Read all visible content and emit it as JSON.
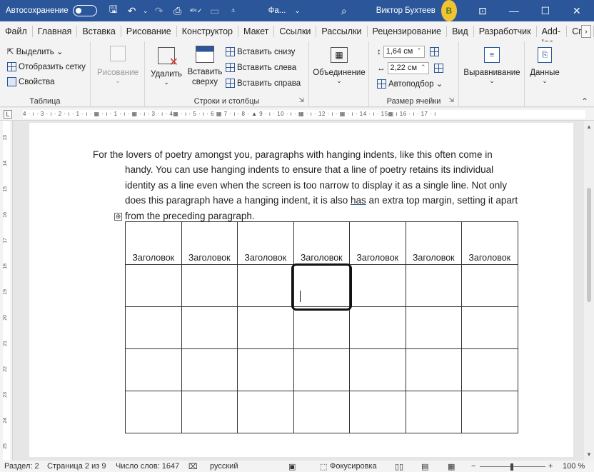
{
  "titlebar": {
    "autosave_label": "Автосохранение",
    "doc_title": "Фа...",
    "doc_title_arrow": "⌄",
    "user_name": "Виктор Бухтеев",
    "avatar_initial": "В",
    "icons": [
      "save-icon",
      "undo-icon",
      "redo-icon",
      "print-preview-icon",
      "spelling-icon",
      "form-icon",
      "customize-quick-access-icon",
      "search-icon",
      "ribbon-display-icon",
      "minimize-icon",
      "maximize-icon",
      "close-icon"
    ],
    "accent_color": "#2b579a"
  },
  "tabs": [
    "Файл",
    "Главная",
    "Вставка",
    "Рисование",
    "Конструктор",
    "Макет",
    "Ссылки",
    "Рассылки",
    "Рецензирование",
    "Вид",
    "Разработчик",
    "Add-Ins",
    "Спр"
  ],
  "ribbon": {
    "table_group": {
      "select": "Выделить ⌄",
      "show_grid": "Отобразить сетку",
      "properties": "Свойства",
      "label": "Таблица"
    },
    "draw_group": {
      "draw": "Рисование"
    },
    "rows_cols_group": {
      "delete": "Удалить",
      "insert_above_line1": "Вставить",
      "insert_above_line2": "сверху",
      "insert_below": "Вставить снизу",
      "insert_left": "Вставить слева",
      "insert_right": "Вставить справа",
      "label": "Строки и столбцы"
    },
    "merge_group": {
      "merge": "Объединение"
    },
    "size_group": {
      "height": "1,64 см",
      "width": "2,22 см",
      "autofit": "Автоподбор ⌄",
      "label": "Размер ячейки"
    },
    "align_group": {
      "align": "Выравнивание"
    },
    "data_group": {
      "data": "Данные"
    }
  },
  "ruler": {
    "marks": "4 · ı · 3 · ı · 2 · ı · 1 · ı · ▦ · ı · 1 · ı · ▦ · ı · 3 · ı · 4▦ · ı · 5 · ı · 6 ▦ 7 · ı · 8 · ▲ 9 · ı · 10 · ı · ▦ · ı · 12 · ı · ▦ · ı · 14 · ı · 15▦ ı 16 · ı · 17 · ı",
    "tab_stop": "L",
    "vertical_numbers": [
      "13",
      "14",
      "15",
      "16",
      "17",
      "18",
      "19",
      "20",
      "21",
      "22",
      "23",
      "24",
      "25"
    ]
  },
  "document": {
    "paragraph": "For the lovers of poetry amongst you, paragraphs with hanging indents, like this often come in handy. You can use hanging indents to ensure that a line of poetry retains its individual identity as a line even when the screen is  too narrow to display it as a single line. Not only does this paragraph have a hanging indent, it is also ",
    "underlined_word": "has",
    "paragraph_end": " an extra top margin, setting it apart from the preceding paragraph.",
    "move_handle": "⊕",
    "table": {
      "headers": [
        "Заголовок",
        "Заголовок",
        "Заголовок",
        "Заголовок",
        "Заголовок",
        "Заголовок",
        "Заголовок"
      ],
      "body_rows": 4,
      "selected_cell": {
        "row": 0,
        "col": 3
      }
    }
  },
  "statusbar": {
    "section": "Раздел: 2",
    "page": "Страница 2 из 9",
    "words": "Число слов: 1647",
    "language": "русский",
    "focus": "Фокусировка",
    "zoom_minus": "−",
    "zoom_plus": "+",
    "zoom": "100 %",
    "zoom_fraction": 0.5
  }
}
